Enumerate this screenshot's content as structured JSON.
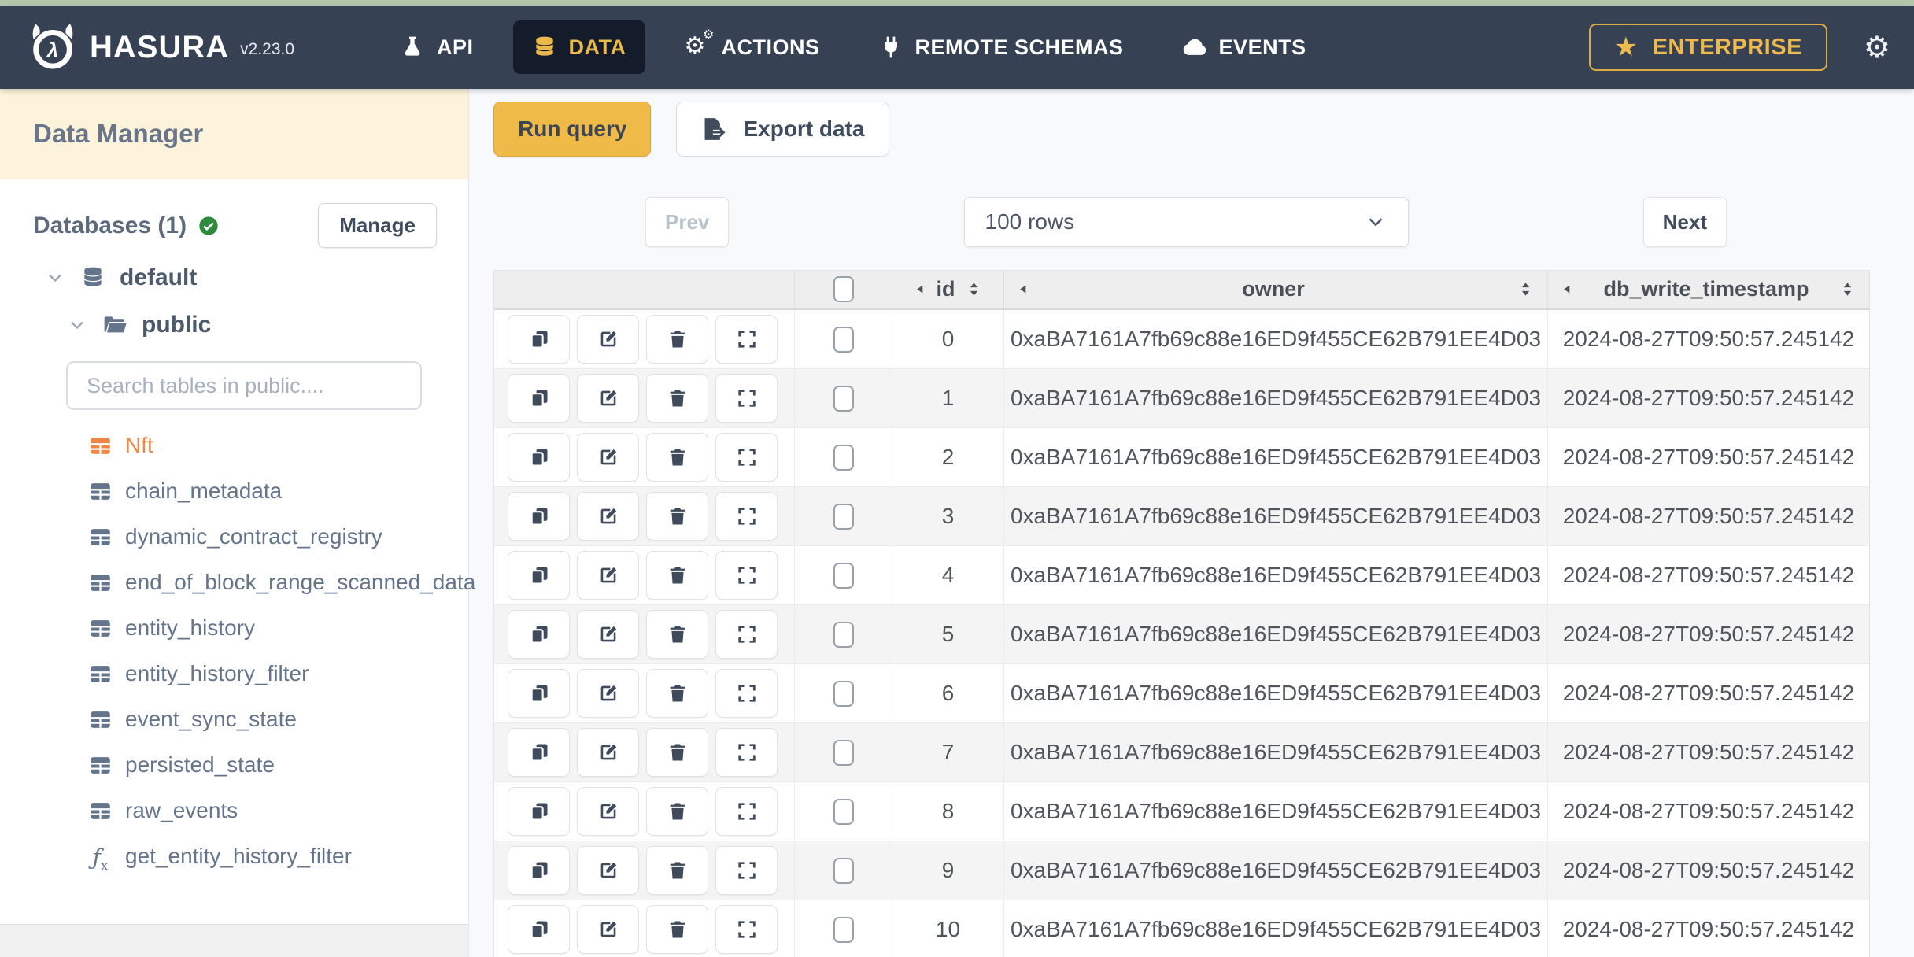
{
  "chrome": {
    "top_strip_color": "#b4c7ae"
  },
  "nav": {
    "brand": "HASURA",
    "version": "v2.23.0",
    "items": [
      {
        "label": "API",
        "icon": "flask-icon",
        "active": false
      },
      {
        "label": "DATA",
        "icon": "database-icon",
        "active": true
      },
      {
        "label": "ACTIONS",
        "icon": "gears-icon",
        "active": false
      },
      {
        "label": "REMOTE SCHEMAS",
        "icon": "plug-icon",
        "active": false
      },
      {
        "label": "EVENTS",
        "icon": "cloud-icon",
        "active": false
      }
    ],
    "enterprise": {
      "label": "ENTERPRISE",
      "icon": "star-icon"
    },
    "settings_icon": "gear-icon"
  },
  "sidebar": {
    "title": "Data Manager",
    "databases": {
      "label": "Databases (1)",
      "status_icon": "check-circle-icon",
      "manage_label": "Manage"
    },
    "tree": {
      "database_name": "default",
      "schema_name": "public"
    },
    "search_placeholder": "Search tables in public....",
    "tables": [
      {
        "name": "Nft",
        "active": true
      },
      {
        "name": "chain_metadata",
        "active": false
      },
      {
        "name": "dynamic_contract_registry",
        "active": false
      },
      {
        "name": "end_of_block_range_scanned_data",
        "active": false
      },
      {
        "name": "entity_history",
        "active": false
      },
      {
        "name": "entity_history_filter",
        "active": false
      },
      {
        "name": "event_sync_state",
        "active": false
      },
      {
        "name": "persisted_state",
        "active": false
      },
      {
        "name": "raw_events",
        "active": false
      }
    ],
    "functions": [
      {
        "name": "get_entity_history_filter"
      }
    ]
  },
  "toolbar": {
    "run_query_label": "Run query",
    "export_data_label": "Export data"
  },
  "pagination": {
    "prev_label": "Prev",
    "page_size_value": "100 rows",
    "next_label": "Next"
  },
  "data_table": {
    "columns": [
      {
        "key": "id",
        "label": "id"
      },
      {
        "key": "owner",
        "label": "owner"
      },
      {
        "key": "db_write_timestamp",
        "label": "db_write_timestamp"
      }
    ],
    "rows": [
      {
        "id": "0",
        "owner": "0xaBA7161A7fb69c88e16ED9f455CE62B791EE4D03",
        "db_write_timestamp": "2024-08-27T09:50:57.245142"
      },
      {
        "id": "1",
        "owner": "0xaBA7161A7fb69c88e16ED9f455CE62B791EE4D03",
        "db_write_timestamp": "2024-08-27T09:50:57.245142"
      },
      {
        "id": "2",
        "owner": "0xaBA7161A7fb69c88e16ED9f455CE62B791EE4D03",
        "db_write_timestamp": "2024-08-27T09:50:57.245142"
      },
      {
        "id": "3",
        "owner": "0xaBA7161A7fb69c88e16ED9f455CE62B791EE4D03",
        "db_write_timestamp": "2024-08-27T09:50:57.245142"
      },
      {
        "id": "4",
        "owner": "0xaBA7161A7fb69c88e16ED9f455CE62B791EE4D03",
        "db_write_timestamp": "2024-08-27T09:50:57.245142"
      },
      {
        "id": "5",
        "owner": "0xaBA7161A7fb69c88e16ED9f455CE62B791EE4D03",
        "db_write_timestamp": "2024-08-27T09:50:57.245142"
      },
      {
        "id": "6",
        "owner": "0xaBA7161A7fb69c88e16ED9f455CE62B791EE4D03",
        "db_write_timestamp": "2024-08-27T09:50:57.245142"
      },
      {
        "id": "7",
        "owner": "0xaBA7161A7fb69c88e16ED9f455CE62B791EE4D03",
        "db_write_timestamp": "2024-08-27T09:50:57.245142"
      },
      {
        "id": "8",
        "owner": "0xaBA7161A7fb69c88e16ED9f455CE62B791EE4D03",
        "db_write_timestamp": "2024-08-27T09:50:57.245142"
      },
      {
        "id": "9",
        "owner": "0xaBA7161A7fb69c88e16ED9f455CE62B791EE4D03",
        "db_write_timestamp": "2024-08-27T09:50:57.245142"
      },
      {
        "id": "10",
        "owner": "0xaBA7161A7fb69c88e16ED9f455CE62B791EE4D03",
        "db_write_timestamp": "2024-08-27T09:50:57.245142"
      }
    ]
  },
  "colors": {
    "nav_bg": "#364153",
    "active_pill_bg": "#141b2b",
    "accent_gold": "#e9b949",
    "run_button_gold": "#f0ba48",
    "brand_orange": "#ee8645",
    "cream_header": "#fcf3da",
    "green_check": "#2f8a3d",
    "top_strip": "#b4c7ae"
  }
}
